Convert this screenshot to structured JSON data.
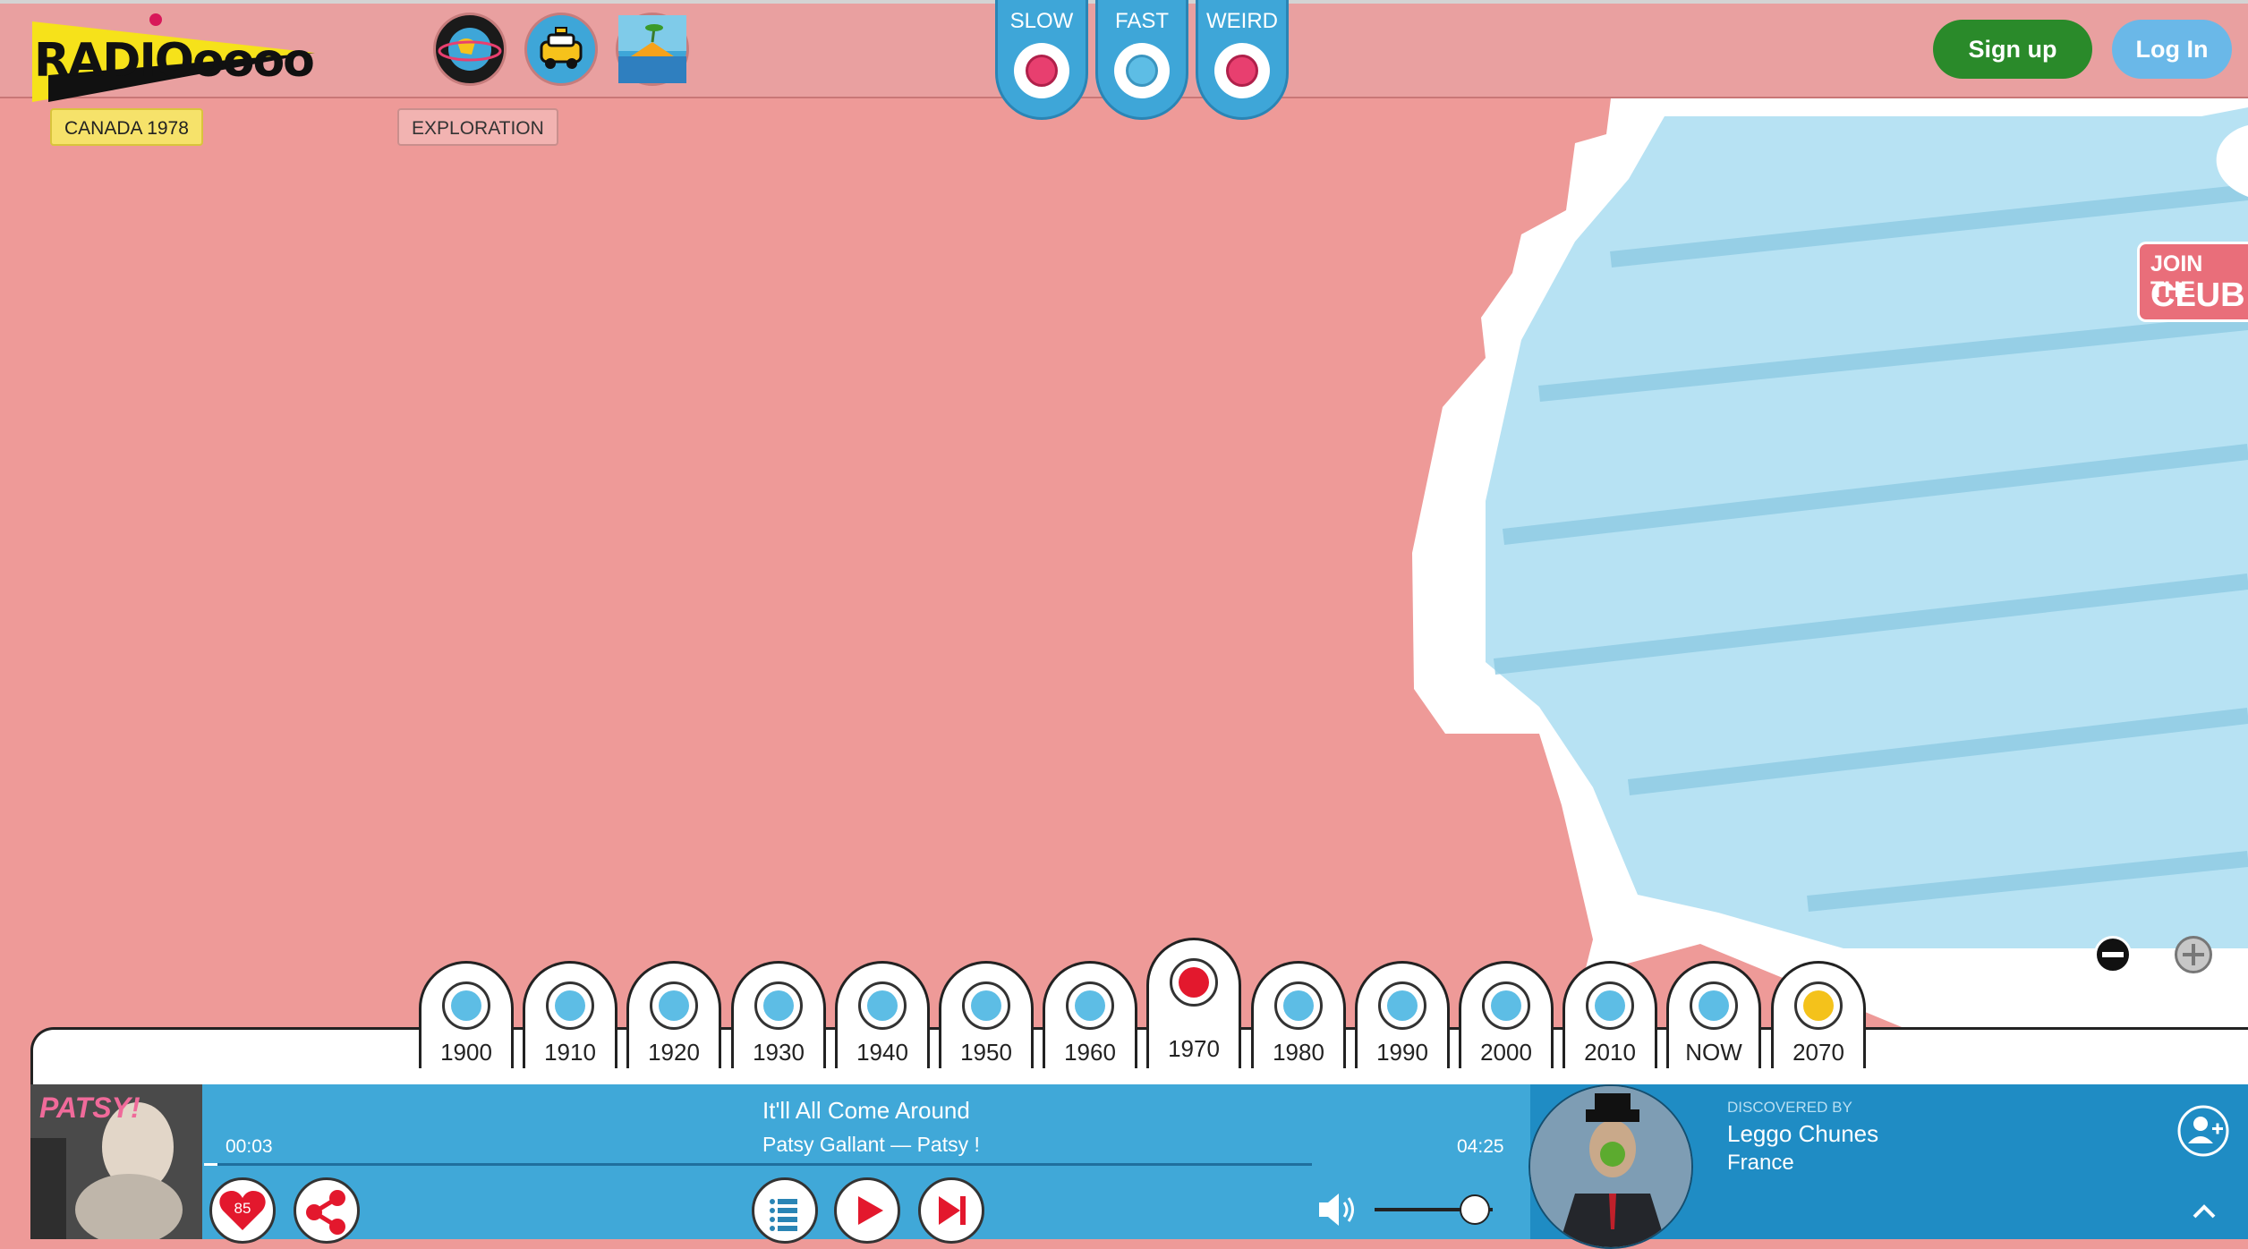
{
  "header": {
    "logo_text": "RADIOoooo",
    "location_tag": "CANADA 1978",
    "mode_tag": "EXPLORATION",
    "icons": [
      "globe-icon",
      "taxi-icon",
      "island-icon"
    ],
    "modes": [
      {
        "label": "SLOW",
        "color": "#e83f6f"
      },
      {
        "label": "FAST",
        "color": "#5dbde5"
      },
      {
        "label": "WEIRD",
        "color": "#e83f6f"
      }
    ],
    "signup_label": "Sign up",
    "login_label": "Log In"
  },
  "side_banner": {
    "line1": "JOIN THE",
    "line2": "CLUB"
  },
  "decades": [
    {
      "label": "1900",
      "color": "#5dbde5"
    },
    {
      "label": "1910",
      "color": "#5dbde5"
    },
    {
      "label": "1920",
      "color": "#5dbde5"
    },
    {
      "label": "1930",
      "color": "#5dbde5"
    },
    {
      "label": "1940",
      "color": "#5dbde5"
    },
    {
      "label": "1950",
      "color": "#5dbde5"
    },
    {
      "label": "1960",
      "color": "#5dbde5"
    },
    {
      "label": "1970",
      "color": "#e3182d",
      "active": true
    },
    {
      "label": "1980",
      "color": "#5dbde5"
    },
    {
      "label": "1990",
      "color": "#5dbde5"
    },
    {
      "label": "2000",
      "color": "#5dbde5"
    },
    {
      "label": "2010",
      "color": "#5dbde5"
    },
    {
      "label": "NOW",
      "color": "#5dbde5"
    },
    {
      "label": "2070",
      "color": "#f4c21b"
    }
  ],
  "player": {
    "album_text": "PATSY!",
    "elapsed": "00:03",
    "duration": "04:25",
    "progress": 0.012,
    "title": "It'll All Come Around",
    "artist_album": "Patsy Gallant — Patsy !",
    "likes": "85",
    "volume": 0.85,
    "discovered_by_label": "DISCOVERED BY",
    "discoverer_name": "Leggo Chunes",
    "discoverer_country": "France"
  },
  "colors": {
    "land": "#ee9a98",
    "water": "#b7e2f3",
    "accent_blue": "#40a8d8",
    "signup_green": "#2a8a2a",
    "login_blue": "#6ab8e8"
  }
}
